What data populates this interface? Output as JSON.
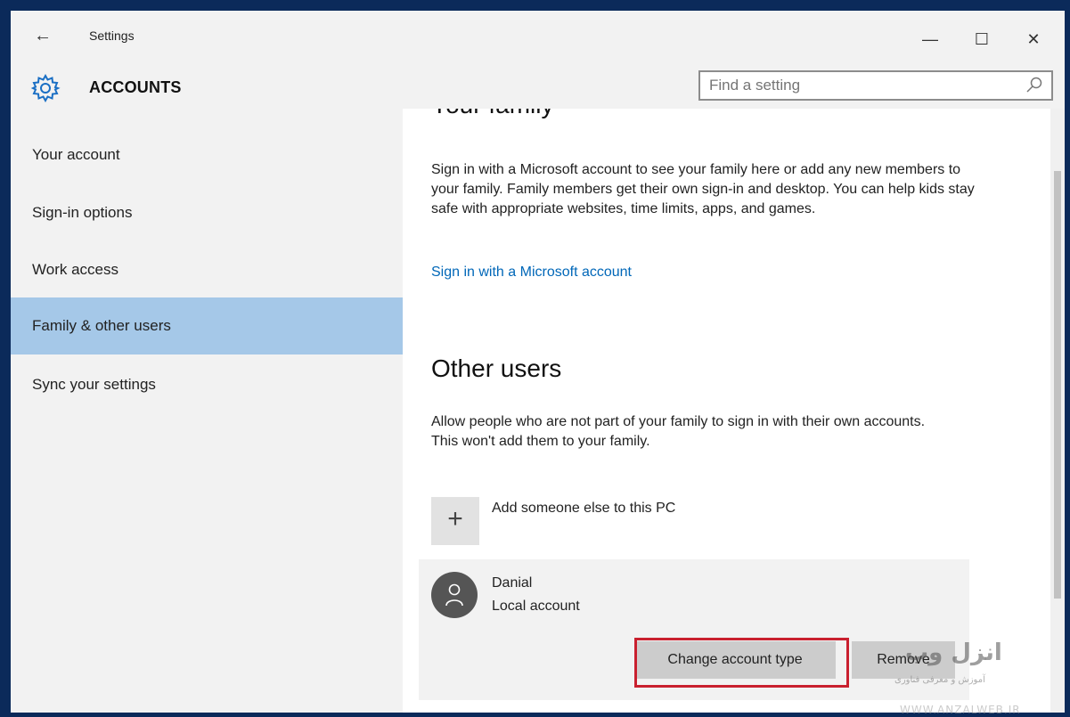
{
  "window": {
    "title": "Settings",
    "controls": {
      "minimize": "—",
      "maximize": "☐",
      "close": "✕"
    }
  },
  "header": {
    "section": "ACCOUNTS",
    "search_placeholder": "Find a setting"
  },
  "sidebar": {
    "items": [
      {
        "label": "Your account"
      },
      {
        "label": "Sign-in options"
      },
      {
        "label": "Work access"
      },
      {
        "label": "Family & other users",
        "active": true
      },
      {
        "label": "Sync your settings"
      }
    ]
  },
  "content": {
    "family": {
      "title": "Your family",
      "description": "Sign in with a Microsoft account to see your family here or add any new members to your family. Family members get their own sign-in and desktop. You can help kids stay safe with appropriate websites, time limits, apps, and games.",
      "link": "Sign in with a Microsoft account"
    },
    "other_users": {
      "title": "Other users",
      "description": "Allow people who are not part of your family to sign in with their own accounts. This won't add them to your family.",
      "add_label": "Add someone else to this PC",
      "user": {
        "name": "Danial",
        "type": "Local account",
        "change_button": "Change account type",
        "remove_button": "Remove"
      }
    }
  },
  "watermark": {
    "logo_text": "انزل وب",
    "tagline": "آموزش و معرفی فناوری",
    "url": "WWW.ANZALWEB.IR"
  },
  "colors": {
    "accent": "#0067b8",
    "selected_nav": "#a5c8e8",
    "highlight_border": "#c9202f",
    "frame": "#0b2a5a"
  }
}
